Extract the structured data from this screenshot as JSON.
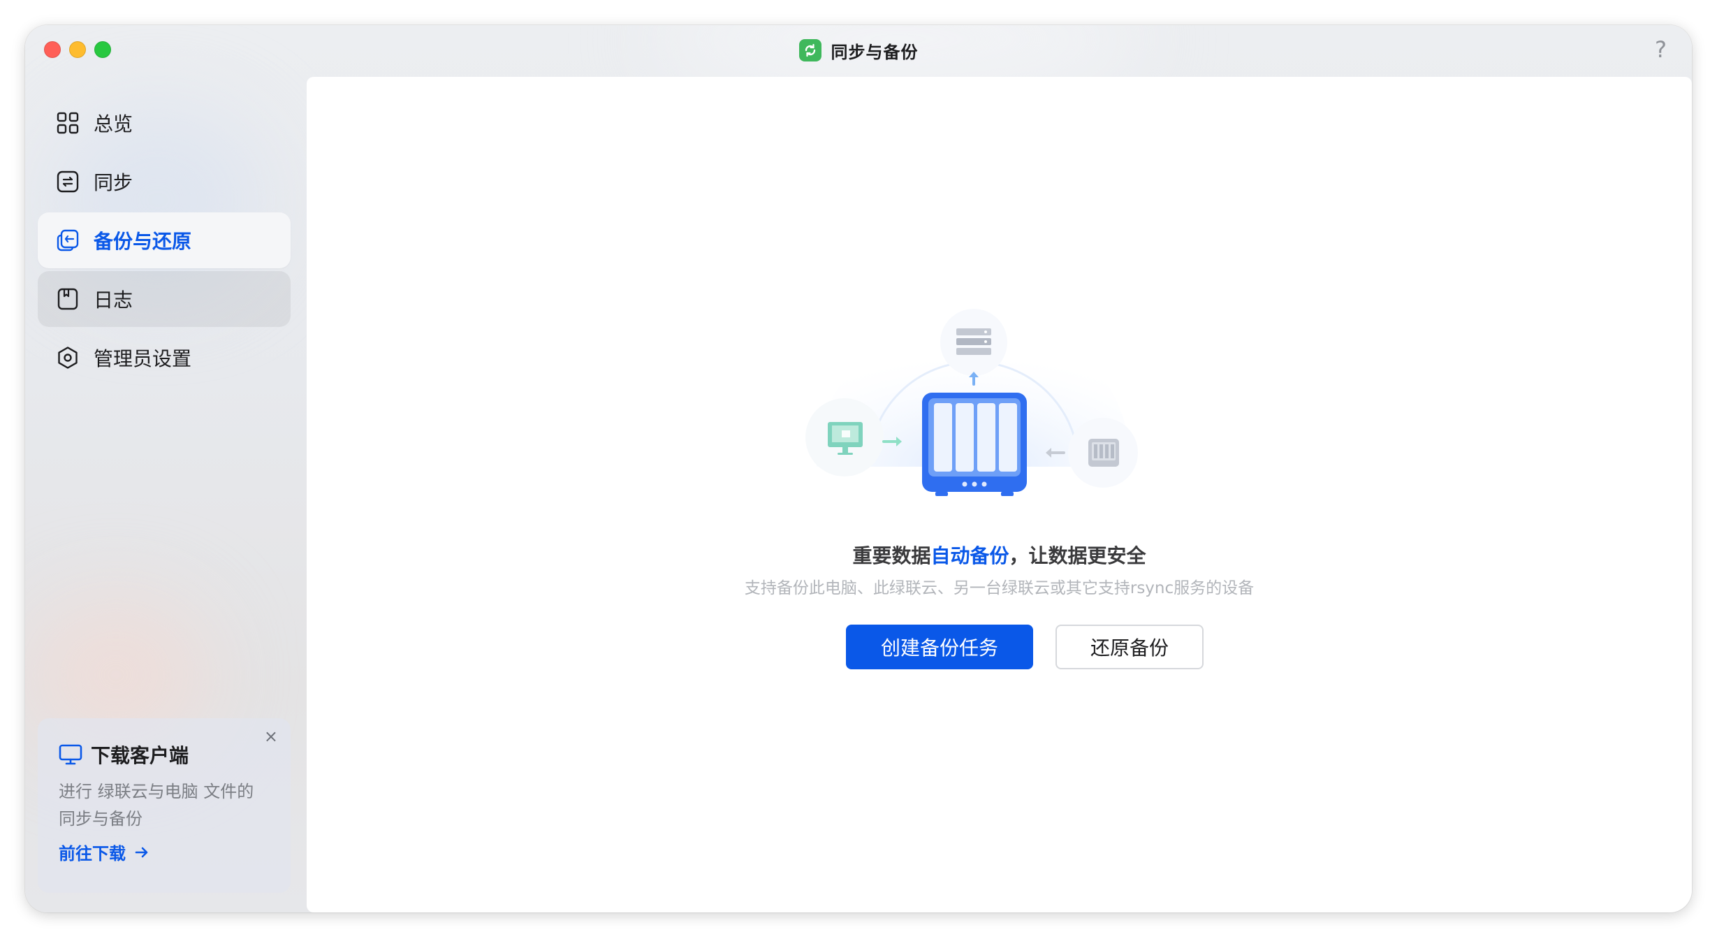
{
  "window": {
    "title": "同步与备份",
    "help": "?"
  },
  "sidebar": {
    "items": [
      {
        "label": "总览",
        "icon": "grid-icon"
      },
      {
        "label": "同步",
        "icon": "sync-icon"
      },
      {
        "label": "备份与还原",
        "icon": "backup-restore-icon",
        "active": true
      },
      {
        "label": "日志",
        "icon": "log-icon"
      },
      {
        "label": "管理员设置",
        "icon": "settings-icon"
      }
    ]
  },
  "promo": {
    "title": "下载客户端",
    "description": "进行 绿联云与电脑 文件的同步与备份",
    "link": "前往下载",
    "close": "×"
  },
  "main": {
    "headline_pre": "重要数据",
    "headline_highlight": "自动备份",
    "headline_post": "，让数据更安全",
    "subline": "支持备份此电脑、此绿联云、另一台绿联云或其它支持rsync服务的设备",
    "primary_button": "创建备份任务",
    "secondary_button": "还原备份"
  },
  "colors": {
    "accent": "#0a58e8",
    "app_icon": "#3fb85c"
  }
}
